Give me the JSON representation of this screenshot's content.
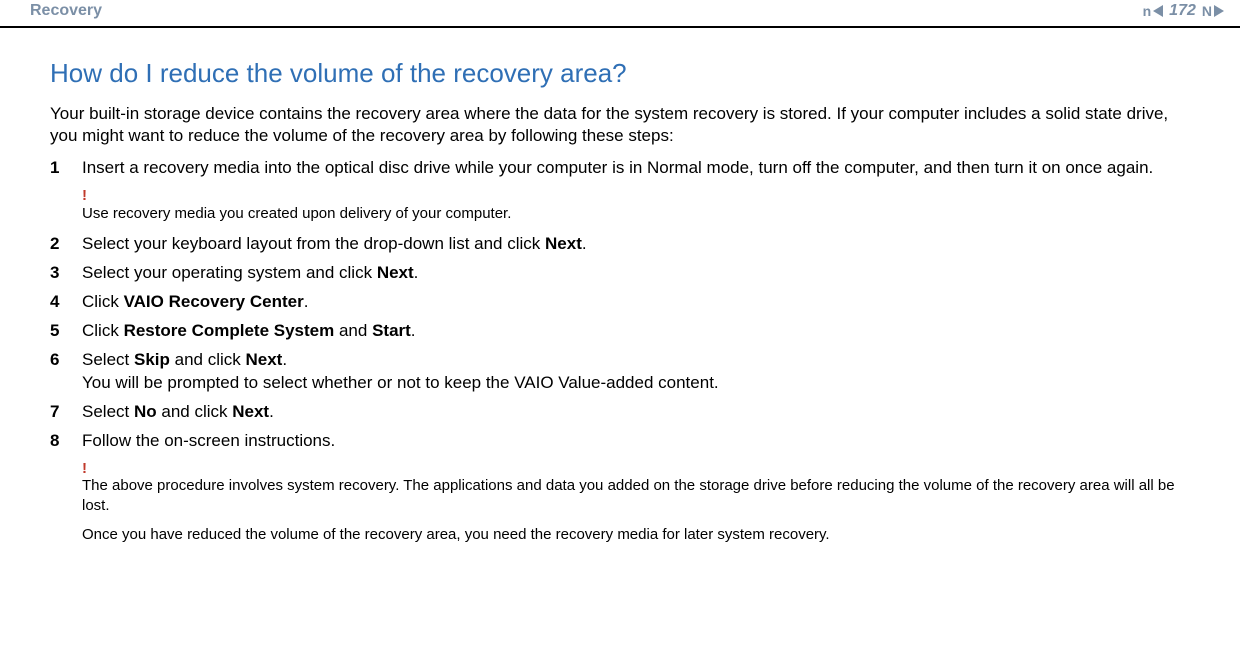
{
  "header": {
    "title": "Recovery",
    "page_number": "172",
    "n_label": "n",
    "N_label": "N"
  },
  "question": "How do I reduce the volume of the recovery area?",
  "lead": "Your built-in storage device contains the recovery area where the data for the system recovery is stored. If your computer includes a solid state drive, you might want to reduce the volume of the recovery area by following these steps:",
  "steps": {
    "s1_num": "1",
    "s1_text": "Insert a recovery media into the optical disc drive while your computer is in Normal mode, turn off the computer, and then turn it on once again.",
    "s2_num": "2",
    "s2_a": "Select your keyboard layout from the drop-down list and click ",
    "s2_b": "Next",
    "s2_c": ".",
    "s3_num": "3",
    "s3_a": "Select your operating system and click ",
    "s3_b": "Next",
    "s3_c": ".",
    "s4_num": "4",
    "s4_a": "Click ",
    "s4_b": "VAIO Recovery Center",
    "s4_c": ".",
    "s5_num": "5",
    "s5_a": "Click ",
    "s5_b": "Restore Complete System",
    "s5_c": " and ",
    "s5_d": "Start",
    "s5_e": ".",
    "s6_num": "6",
    "s6_a": "Select ",
    "s6_b": "Skip",
    "s6_c": " and click ",
    "s6_d": "Next",
    "s6_e": ".",
    "s6_line2": "You will be prompted to select whether or not to keep the VAIO Value-added content.",
    "s7_num": "7",
    "s7_a": "Select ",
    "s7_b": "No",
    "s7_c": " and click ",
    "s7_d": "Next",
    "s7_e": ".",
    "s8_num": "8",
    "s8_text": "Follow the on-screen instructions."
  },
  "notes": {
    "bang": "!",
    "note1": "Use recovery media you created upon delivery of your computer.",
    "note2": "The above procedure involves system recovery. The applications and data you added on the storage drive before reducing the volume of the recovery area will all be lost.",
    "note3": "Once you have reduced the volume of the recovery area, you need the recovery media for later system recovery."
  }
}
